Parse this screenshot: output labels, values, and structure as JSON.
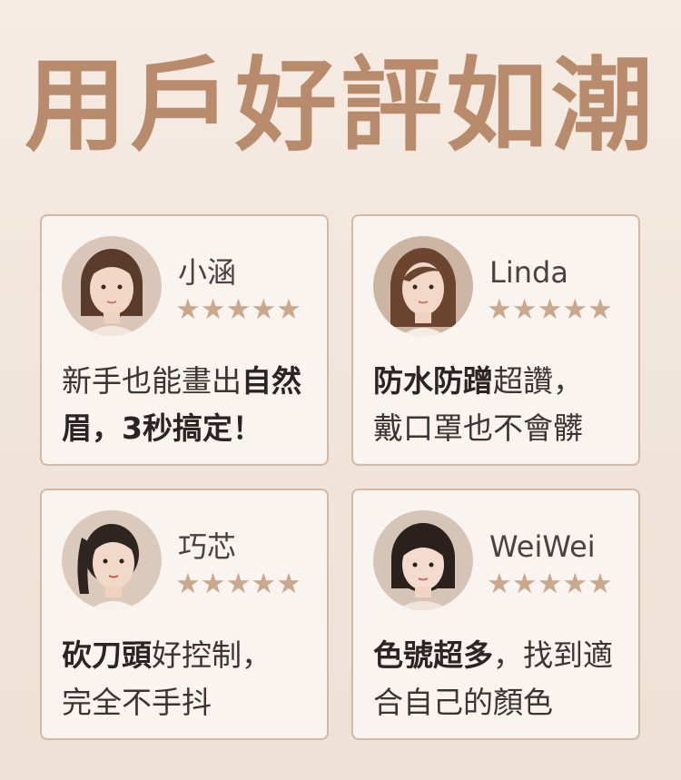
{
  "title": "用戶好評如潮",
  "reviews": [
    {
      "name": "小涵",
      "stars": "★★★★★",
      "text_bold_1": "",
      "text_1": "新手也能畫出",
      "text_bold_2": "自然眉",
      "text_2": "，3秒搞定！",
      "hair_color": "#5a3a2a"
    },
    {
      "name": "Linda",
      "stars": "★★★★★",
      "text_bold_1": "防水防蹭",
      "text_1": "超讚，",
      "text_bold_2": "",
      "text_2": "戴口罩也不會髒",
      "hair_color": "#6b4530"
    },
    {
      "name": "巧芯",
      "stars": "★★★★★",
      "text_bold_1": "砍刀頭",
      "text_1": "好控制，",
      "text_bold_2": "",
      "text_2": "完全不手抖",
      "hair_color": "#2e2420"
    },
    {
      "name": "WeiWei",
      "stars": "★★★★★",
      "text_bold_1": "色號超多",
      "text_1": "，找到適",
      "text_bold_2": "",
      "text_2": "合自己的顏色",
      "hair_color": "#2a201c"
    }
  ],
  "colors": {
    "title": "#b78b6b",
    "star": "#c9a88e",
    "card_border": "#d4b8a2",
    "card_bg": "#f9f4ef"
  }
}
